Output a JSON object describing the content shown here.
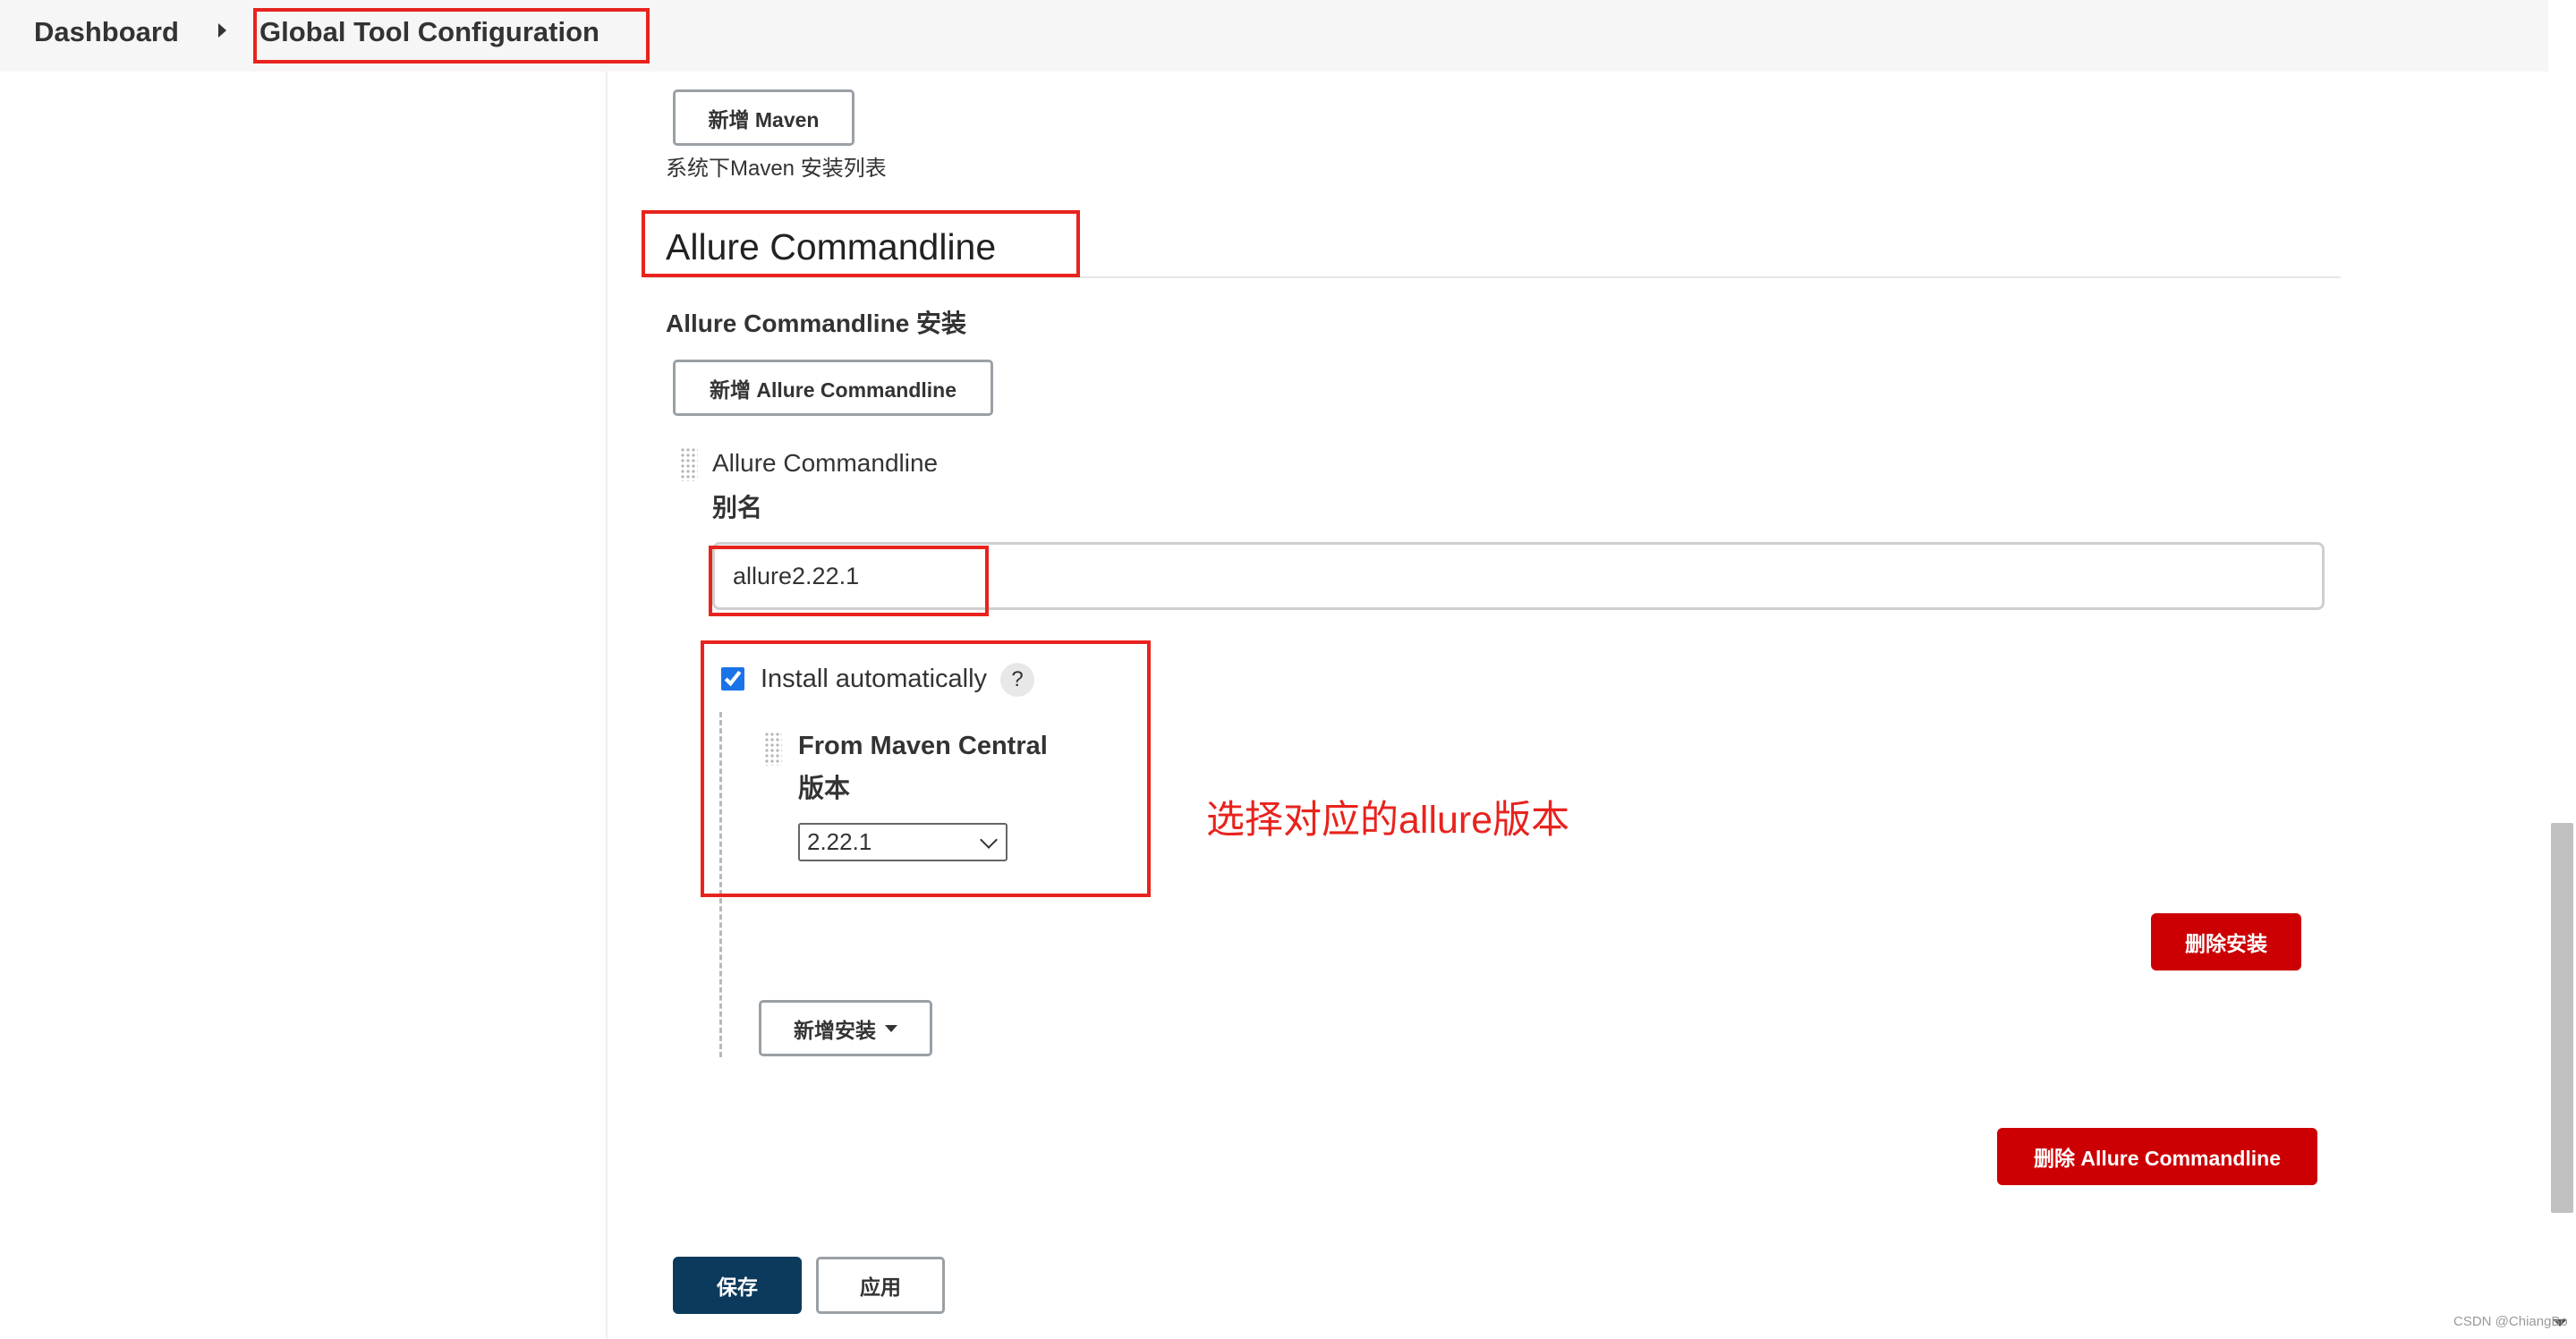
{
  "breadcrumb": {
    "items": [
      "Dashboard",
      "Global Tool Configuration"
    ],
    "separator_icon": "chevron-right-icon"
  },
  "maven": {
    "add_button": "新增 Maven",
    "description": "系统下Maven 安装列表"
  },
  "allure": {
    "section_title": "Allure Commandline",
    "install_label": "Allure Commandline 安装",
    "add_button": "新增 Allure Commandline",
    "item": {
      "heading": "Allure Commandline",
      "alias_label": "别名",
      "alias_value": "allure2.22.1",
      "install_automatically": {
        "label": "Install automatically",
        "checked": true,
        "help": "?"
      },
      "installer": {
        "title": "From Maven Central",
        "version_label": "版本",
        "version_selected": "2.22.1"
      },
      "delete_install_button": "删除安装",
      "add_installer_button": "新增安装"
    },
    "delete_button": "删除 Allure Commandline"
  },
  "annotation": "选择对应的allure版本",
  "footer": {
    "save": "保存",
    "apply": "应用"
  },
  "watermark": "CSDN @ChiangBo",
  "colors": {
    "highlight": "#e8231d",
    "danger": "#cc0003",
    "primary": "#0b3a5c"
  }
}
